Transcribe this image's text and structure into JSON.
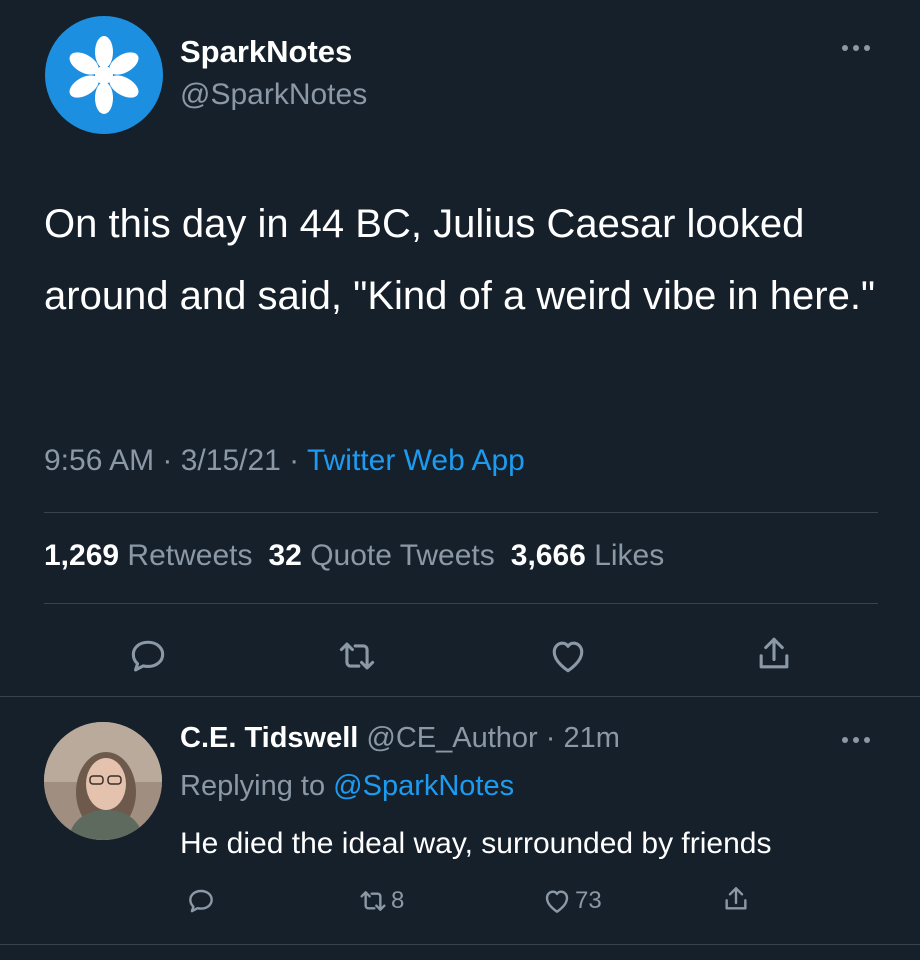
{
  "tweet": {
    "author_name": "SparkNotes",
    "author_handle": "@SparkNotes",
    "text": "On this day in 44 BC, Julius Caesar looked around and said, \"Kind of a weird vibe in here.\"",
    "time": "9:56 AM",
    "date": "3/15/21",
    "source": "Twitter Web App",
    "separator": " · ",
    "avatar_icon": "sparknotes-logo-icon",
    "more_icon": "more-options-icon"
  },
  "stats": {
    "retweets_count": "1,269",
    "retweets_label": "Retweets",
    "quote_count": "32",
    "quote_label": "Quote Tweets",
    "likes_count": "3,666",
    "likes_label": "Likes"
  },
  "actions": {
    "reply_icon": "reply-icon",
    "retweet_icon": "retweet-icon",
    "like_icon": "heart-icon",
    "share_icon": "share-icon"
  },
  "reply": {
    "author_name": "C.E. Tidswell",
    "author_handle": "@CE_Author",
    "separator": " · ",
    "time_ago": "21m",
    "replying_prefix": "Replying to",
    "replying_to": "@SparkNotes",
    "text": "He died the ideal way, surrounded by friends",
    "retweet_count": "8",
    "like_count": "73"
  },
  "colors": {
    "background": "#15202b",
    "text_primary": "#ffffff",
    "text_secondary": "#8b98a5",
    "accent": "#1d9bf0",
    "divider": "#38444d",
    "avatar_blue": "#1d8fe0"
  }
}
